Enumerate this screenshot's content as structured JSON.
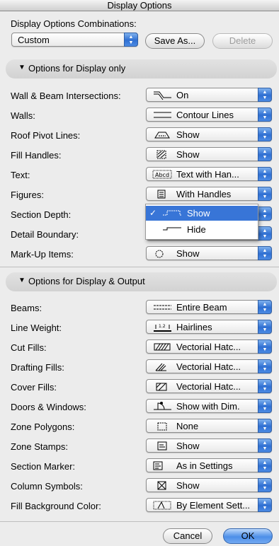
{
  "window": {
    "title": "Display Options"
  },
  "combinations": {
    "label": "Display Options Combinations:",
    "selected": "Custom",
    "save_as": "Save As...",
    "delete": "Delete"
  },
  "section_display_only": {
    "title": "Options for Display only",
    "rows": [
      {
        "label": "Wall & Beam Intersections:",
        "value": "On",
        "icon": "intersection-icon"
      },
      {
        "label": "Walls:",
        "value": "Contour Lines",
        "icon": "contour-lines-icon"
      },
      {
        "label": "Roof Pivot Lines:",
        "value": "Show",
        "icon": "roof-icon"
      },
      {
        "label": "Fill Handles:",
        "value": "Show",
        "icon": "hatch-icon"
      },
      {
        "label": "Text:",
        "value": "Text with Han...",
        "icon": "text-handles-icon"
      },
      {
        "label": "Figures:",
        "value": "With Handles",
        "icon": "figure-icon"
      },
      {
        "label": "Section Depth:",
        "value": "Show",
        "icon": "section-depth-icon"
      },
      {
        "label": "Detail Boundary:",
        "value": "",
        "icon": "detail-boundary-icon"
      },
      {
        "label": "Mark-Up Items:",
        "value": "Show",
        "icon": "markup-cloud-icon"
      }
    ]
  },
  "section_depth_menu": {
    "items": [
      {
        "label": "Show",
        "checked": true
      },
      {
        "label": "Hide",
        "checked": false
      }
    ]
  },
  "section_display_output": {
    "title": "Options for Display & Output",
    "rows": [
      {
        "label": "Beams:",
        "value": "Entire Beam",
        "icon": "beam-icon"
      },
      {
        "label": "Line Weight:",
        "value": "Hairlines",
        "icon": "line-weight-icon"
      },
      {
        "label": "Cut Fills:",
        "value": "Vectorial Hatc...",
        "icon": "cut-fill-icon"
      },
      {
        "label": "Drafting Fills:",
        "value": "Vectorial Hatc...",
        "icon": "drafting-fill-icon"
      },
      {
        "label": "Cover Fills:",
        "value": "Vectorial Hatc...",
        "icon": "cover-fill-icon"
      },
      {
        "label": "Doors & Windows:",
        "value": "Show with Dim.",
        "icon": "door-window-icon"
      },
      {
        "label": "Zone Polygons:",
        "value": "None",
        "icon": "zone-polygon-icon"
      },
      {
        "label": "Zone Stamps:",
        "value": "Show",
        "icon": "zone-stamp-icon"
      },
      {
        "label": "Section Marker:",
        "value": "As in Settings",
        "icon": "section-marker-icon"
      },
      {
        "label": "Column Symbols:",
        "value": "Show",
        "icon": "column-symbol-icon"
      },
      {
        "label": "Fill Background Color:",
        "value": "By Element Sett...",
        "icon": "fill-background-icon"
      }
    ]
  },
  "footer": {
    "cancel": "Cancel",
    "ok": "OK"
  }
}
